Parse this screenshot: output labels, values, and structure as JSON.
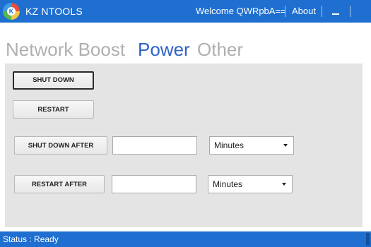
{
  "app": {
    "title": "KZ NTOOLS",
    "welcome": "Welcome QWRpbA==",
    "about": "About",
    "logo_letter": "K",
    "accent_color": "#1e6fd0"
  },
  "tabs": [
    {
      "label": "Network Boost",
      "active": false
    },
    {
      "label": "Power",
      "active": true
    },
    {
      "label": "Other",
      "active": false
    }
  ],
  "power": {
    "shutdown_label": "SHUT DOWN",
    "restart_label": "RESTART",
    "shutdown_after_label": "SHUT DOWN AFTER",
    "restart_after_label": "RESTART AFTER",
    "shutdown_after_value": "",
    "restart_after_value": "",
    "shutdown_unit": "Minutes",
    "restart_unit": "Minutes"
  },
  "status": {
    "text": "Status : Ready"
  },
  "icons": {
    "logo": "app-logo-icon",
    "minimize": "minimize-icon",
    "dropdown": "chevron-down-icon"
  }
}
